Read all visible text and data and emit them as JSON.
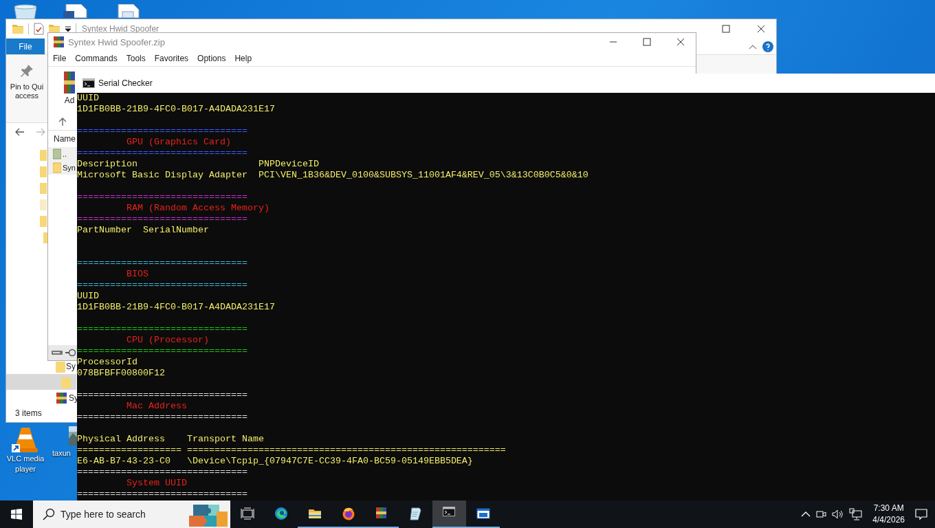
{
  "desktop_icons": [
    {
      "label": "VLC media player",
      "kind": "vlc"
    },
    {
      "label": "taxun"
    }
  ],
  "explorer": {
    "title": "Syntex Hwid Spoofer",
    "file_tab": "File",
    "pin_label_lines": [
      "Pin to Qui",
      "access"
    ],
    "nav_items": [
      {
        "label": "Sy",
        "kind": "folder",
        "selected": false
      },
      {
        "kind": "folder",
        "selected": true
      },
      {
        "label": "Sy",
        "kind": "archive",
        "selected": false
      }
    ],
    "status_bar": "3 items"
  },
  "winrar": {
    "title": "Syntex Hwid Spoofer.zip",
    "menu": [
      "File",
      "Commands",
      "Tools",
      "Favorites",
      "Options",
      "Help"
    ],
    "toolbar_label": "Ad",
    "column": "Name",
    "files": [
      {
        "label": "..",
        "kind": "up"
      },
      {
        "label": "Syn",
        "kind": "folder"
      }
    ]
  },
  "console": {
    "title": "Serial Checker",
    "lines": [
      {
        "kind": "text",
        "text": "UUID"
      },
      {
        "kind": "text",
        "text": "1D1FB0BB-21B9-4FC0-B017-A4DADA231E17"
      },
      {
        "kind": "blank"
      },
      {
        "kind": "rule",
        "text": "===============================",
        "color": "#3b5bff"
      },
      {
        "kind": "heading",
        "text": "         GPU (Graphics Card)"
      },
      {
        "kind": "rule",
        "text": "===============================",
        "color": "#3b5bff"
      },
      {
        "kind": "text",
        "text": "Description                      PNPDeviceID"
      },
      {
        "kind": "text",
        "text": "Microsoft Basic Display Adapter  PCI\\VEN_1B36&DEV_0100&SUBSYS_11001AF4&REV_05\\3&13C0B0C5&0&10"
      },
      {
        "kind": "blank"
      },
      {
        "kind": "rule",
        "text": "===============================",
        "color": "#c030c8"
      },
      {
        "kind": "heading",
        "text": "         RAM (Random Access Memory)"
      },
      {
        "kind": "rule",
        "text": "===============================",
        "color": "#c030c8"
      },
      {
        "kind": "text",
        "text": "PartNumber  SerialNumber"
      },
      {
        "kind": "blank"
      },
      {
        "kind": "blank"
      },
      {
        "kind": "rule",
        "text": "===============================",
        "color": "#3ab8d8"
      },
      {
        "kind": "heading",
        "text": "         BIOS"
      },
      {
        "kind": "rule",
        "text": "===============================",
        "color": "#3ab8d8"
      },
      {
        "kind": "text",
        "text": "UUID"
      },
      {
        "kind": "text",
        "text": "1D1FB0BB-21B9-4FC0-B017-A4DADA231E17"
      },
      {
        "kind": "blank"
      },
      {
        "kind": "rule",
        "text": "===============================",
        "color": "#16c60c"
      },
      {
        "kind": "heading",
        "text": "         CPU (Processor)"
      },
      {
        "kind": "rule",
        "text": "===============================",
        "color": "#16c60c"
      },
      {
        "kind": "text",
        "text": "ProcessorId"
      },
      {
        "kind": "text",
        "text": "078BFBFF00800F12"
      },
      {
        "kind": "blank"
      },
      {
        "kind": "rule",
        "text": "===============================",
        "color": "#e0e0e0"
      },
      {
        "kind": "heading",
        "text": "         Mac Address"
      },
      {
        "kind": "rule",
        "text": "===============================",
        "color": "#e0e0e0"
      },
      {
        "kind": "blank"
      },
      {
        "kind": "text",
        "text": "Physical Address    Transport Name"
      },
      {
        "kind": "text",
        "text": "=================== =========================================================="
      },
      {
        "kind": "text",
        "text": "E6-AB-B7-43-23-C0   \\Device\\Tcpip_{07947C7E-CC39-4FA0-BC59-05149EBB5DEA}"
      },
      {
        "kind": "rule",
        "text": "===============================",
        "color": "#e0e0e0"
      },
      {
        "kind": "heading",
        "text": "         System UUID"
      },
      {
        "kind": "rule",
        "text": "===============================",
        "color": "#e0e0e0"
      }
    ]
  },
  "taskbar": {
    "search": {
      "placeholder": "Type here to search"
    },
    "apps": [
      {
        "kind": "taskview",
        "running": false,
        "selected": false
      },
      {
        "kind": "edge",
        "running": false,
        "selected": false
      },
      {
        "kind": "explorer",
        "running": true,
        "selected": false
      },
      {
        "kind": "firefox",
        "running": true,
        "selected": false
      },
      {
        "kind": "winrar",
        "running": true,
        "selected": false
      },
      {
        "kind": "notepad",
        "running": false,
        "selected": false
      },
      {
        "kind": "cmd",
        "running": true,
        "selected": true
      },
      {
        "kind": "app",
        "running": true,
        "selected": false
      }
    ],
    "time": "7:30 AM",
    "date": "4/4/2026"
  }
}
